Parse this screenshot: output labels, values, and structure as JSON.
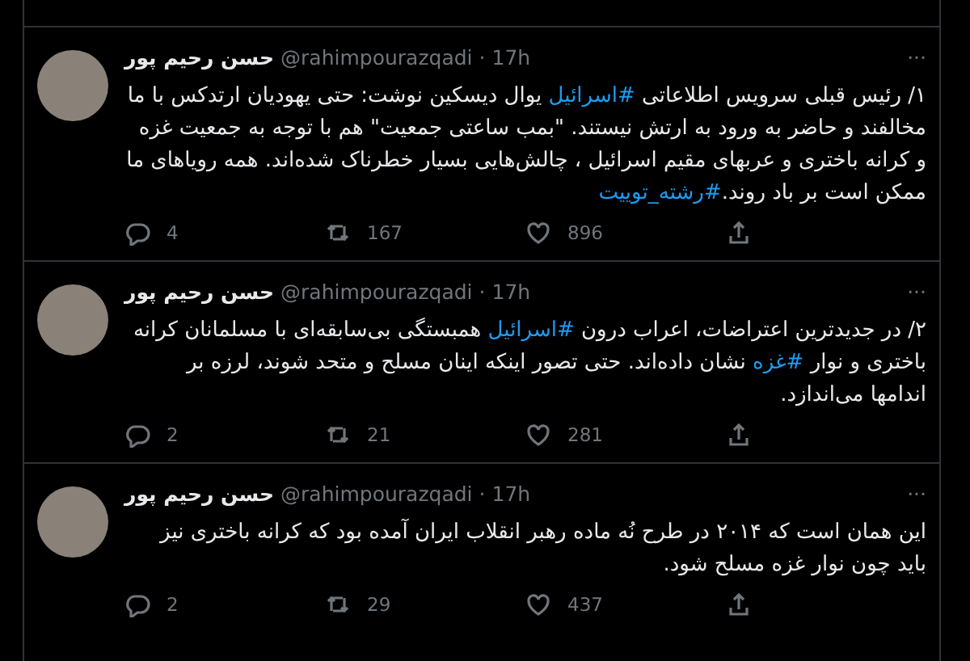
{
  "tweets": [
    {
      "author": "حسن رحیم پور",
      "handle": "@rahimpourazqadi",
      "separator": "·",
      "time": "17h",
      "more": "···",
      "body": [
        {
          "kind": "text",
          "text": "۱/ رئیس قبلی سرویس اطلاعاتی "
        },
        {
          "kind": "hashtag",
          "text": "#اسرائیل"
        },
        {
          "kind": "text",
          "text": " یوال دیسکین نوشت: حتی یهودیان ارتدکس با ما مخالفند و حاضر به ورود به ارتش نیستند. \"بمب ساعتی جمعیت\" هم با توجه به جمعیت غزه و کرانه باختری و عربهای مقیم اسرائیل ، چالش‌هایی بسیار خطرناک شده‌اند. همه رویاهای ما ممکن است بر باد روند."
        },
        {
          "kind": "hashtag",
          "text": "#رشته_توییت"
        }
      ],
      "replies": "4",
      "retweets": "167",
      "likes": "896"
    },
    {
      "author": "حسن رحیم پور",
      "handle": "@rahimpourazqadi",
      "separator": "·",
      "time": "17h",
      "more": "···",
      "body": [
        {
          "kind": "text",
          "text": "۲/ در جدیدترین اعتراضات، اعراب درون "
        },
        {
          "kind": "hashtag",
          "text": "#اسرائیل"
        },
        {
          "kind": "text",
          "text": " همبستگی بی‌سابقه‌ای با مسلمانان کرانه باختری و نوار "
        },
        {
          "kind": "hashtag",
          "text": "#غزه"
        },
        {
          "kind": "text",
          "text": " نشان داده‌اند. حتی تصور اینکه اینان مسلح و متحد شوند، لرزه بر اندامها می‌اندازد."
        }
      ],
      "replies": "2",
      "retweets": "21",
      "likes": "281"
    },
    {
      "author": "حسن رحیم پور",
      "handle": "@rahimpourazqadi",
      "separator": "·",
      "time": "17h",
      "more": "···",
      "body": [
        {
          "kind": "text",
          "text": "این همان است که ۲۰۱۴ در طرح نُه ماده رهبر انقلاب ایران آمده بود که کرانه باختری نیز باید چون نوار غزه مسلح شود."
        }
      ],
      "replies": "2",
      "retweets": "29",
      "likes": "437"
    }
  ]
}
